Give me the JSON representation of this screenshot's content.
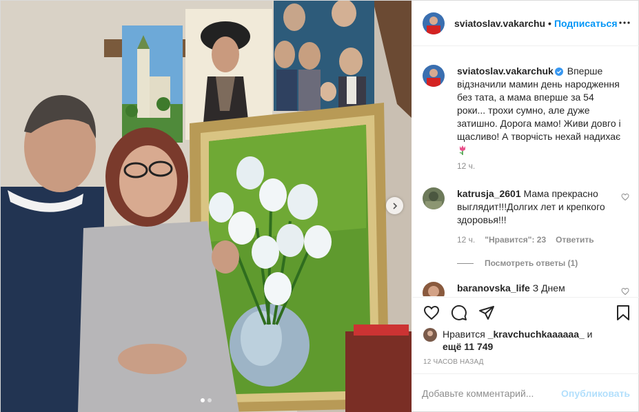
{
  "post": {
    "author": "sviatoslav.vakarchu",
    "follow_label": "Подписаться",
    "separator": "•"
  },
  "caption": {
    "author": "sviatoslav.vakarchuk",
    "text": "Вперше відзначили мамин день народження без тата, а мама вперше за 54 роки... трохи сумно, але дуже затишно. Дорога мамо! Живи довго і щасливо! А творчість нехай надихає",
    "time": "12 ч."
  },
  "comments": [
    {
      "author": "katrusja_2601",
      "text": "Мама прекрасно выглядит!!!Долгих лет и крепкого здоровья!!!",
      "time": "12 ч.",
      "likes_label": "\"Нравится\": 23",
      "reply_label": "Ответить",
      "view_replies": "Посмотреть ответы (1)"
    },
    {
      "author": "baranovska_life",
      "text": "З Днем"
    }
  ],
  "likes": {
    "prefix": "Нравится",
    "user": "_kravchuchkaaaaaa_",
    "and": "и",
    "others": "ещё 11 749"
  },
  "timestamp": "12 ЧАСОВ НАЗАД",
  "add_comment": {
    "placeholder": "Добавьте комментарий...",
    "publish_label": "Опубликовать"
  },
  "carousel": {
    "count": 2,
    "active": 0
  },
  "icons": {
    "more": "more-horizontal-icon",
    "like": "heart-icon",
    "comment": "comment-icon",
    "share": "send-icon",
    "save": "bookmark-icon",
    "verified": "verified-badge-icon",
    "next": "chevron-right-icon",
    "emoji": "tulip-emoji"
  },
  "colors": {
    "accent": "#0095f6",
    "verified": "#3897f0",
    "publish_disabled": "#b2dffc",
    "muted": "#8e8e8e"
  }
}
